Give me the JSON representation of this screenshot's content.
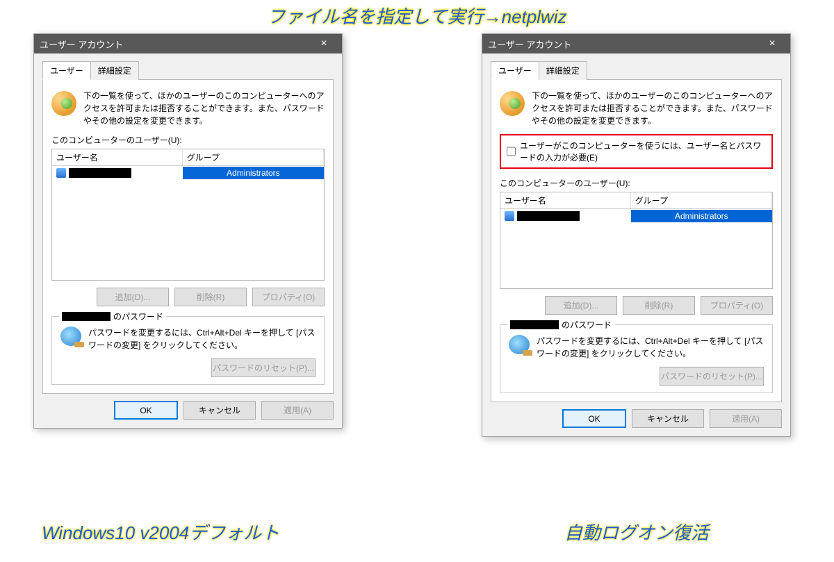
{
  "topTitle": "ファイル名を指定して実行→netplwiz",
  "captions": {
    "left": "Windows10 v2004デフォルト",
    "right": "自動ログオン復活"
  },
  "dialog": {
    "title": "ユーザー アカウント",
    "tabs": {
      "users": "ユーザー",
      "advanced": "詳細設定"
    },
    "introText": "下の一覧を使って、ほかのユーザーのこのコンピューターへのアクセスを許可または拒否することができます。また、パスワードやその他の設定を変更できます。",
    "checkboxLabel": "ユーザーがこのコンピューターを使うには、ユーザー名とパスワードの入力が必要(E)",
    "listLabel": "このコンピューターのユーザー(U):",
    "columns": {
      "name": "ユーザー名",
      "group": "グループ"
    },
    "rowGroup": "Administrators",
    "buttons": {
      "add": "追加(D)...",
      "remove": "削除(R)",
      "properties": "プロパティ(O)",
      "resetPw": "パスワードのリセット(P)...",
      "ok": "OK",
      "cancel": "キャンセル",
      "apply": "適用(A)"
    },
    "passwordGroupSuffix": "のパスワード",
    "passwordText": "パスワードを変更するには、Ctrl+Alt+Del キーを押して [パスワードの変更] をクリックしてください。"
  }
}
